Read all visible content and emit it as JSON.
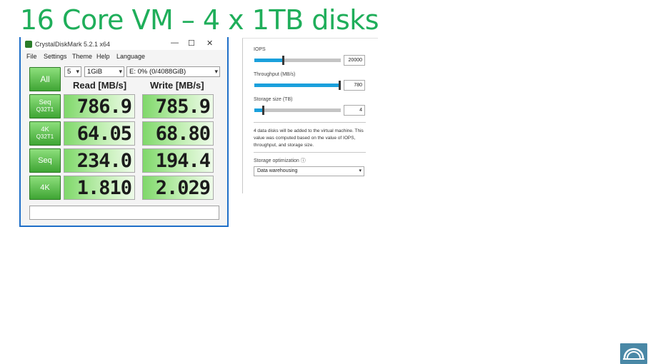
{
  "slide": {
    "title": "16 Core VM – 4 x 1TB disks"
  },
  "cdm": {
    "window_title": "CrystalDiskMark 5.2.1 x64",
    "win_minimize": "—",
    "win_maximize": "☐",
    "win_close": "✕",
    "menu": [
      "File",
      "Settings",
      "Theme",
      "Help",
      "Language"
    ],
    "count": "5",
    "size": "1GiB",
    "drive": "E: 0% (0/4088GiB)",
    "read_header": "Read [MB/s]",
    "write_header": "Write [MB/s]",
    "all_label": "All",
    "tests": [
      {
        "line1": "Seq",
        "line2": "Q32T1",
        "read": "786.9",
        "write": "785.9"
      },
      {
        "line1": "4K",
        "line2": "Q32T1",
        "read": "64.05",
        "write": "68.80"
      },
      {
        "line1": "Seq",
        "line2": "",
        "read": "234.0",
        "write": "194.4"
      },
      {
        "line1": "4K",
        "line2": "",
        "read": "1.810",
        "write": "2.029"
      }
    ]
  },
  "panel": {
    "iops_label": "IOPS",
    "iops_value": "20000",
    "iops_level": 0.33,
    "throughput_label": "Throughput (MB/s)",
    "throughput_value": "780",
    "throughput_level": 0.98,
    "storage_label": "Storage size (TB)",
    "storage_value": "4",
    "storage_level": 0.1,
    "note": "4 data disks will be added to the virtual machine. This value was computed based on the value of IOPS, throughput, and storage size.",
    "optimization_label": "Storage optimization ⓘ",
    "optimization_value": "Data warehousing"
  },
  "colors": {
    "accent": "#1fae5a",
    "slider": "#1aa0dc",
    "cdm_green": "#3fa534"
  }
}
